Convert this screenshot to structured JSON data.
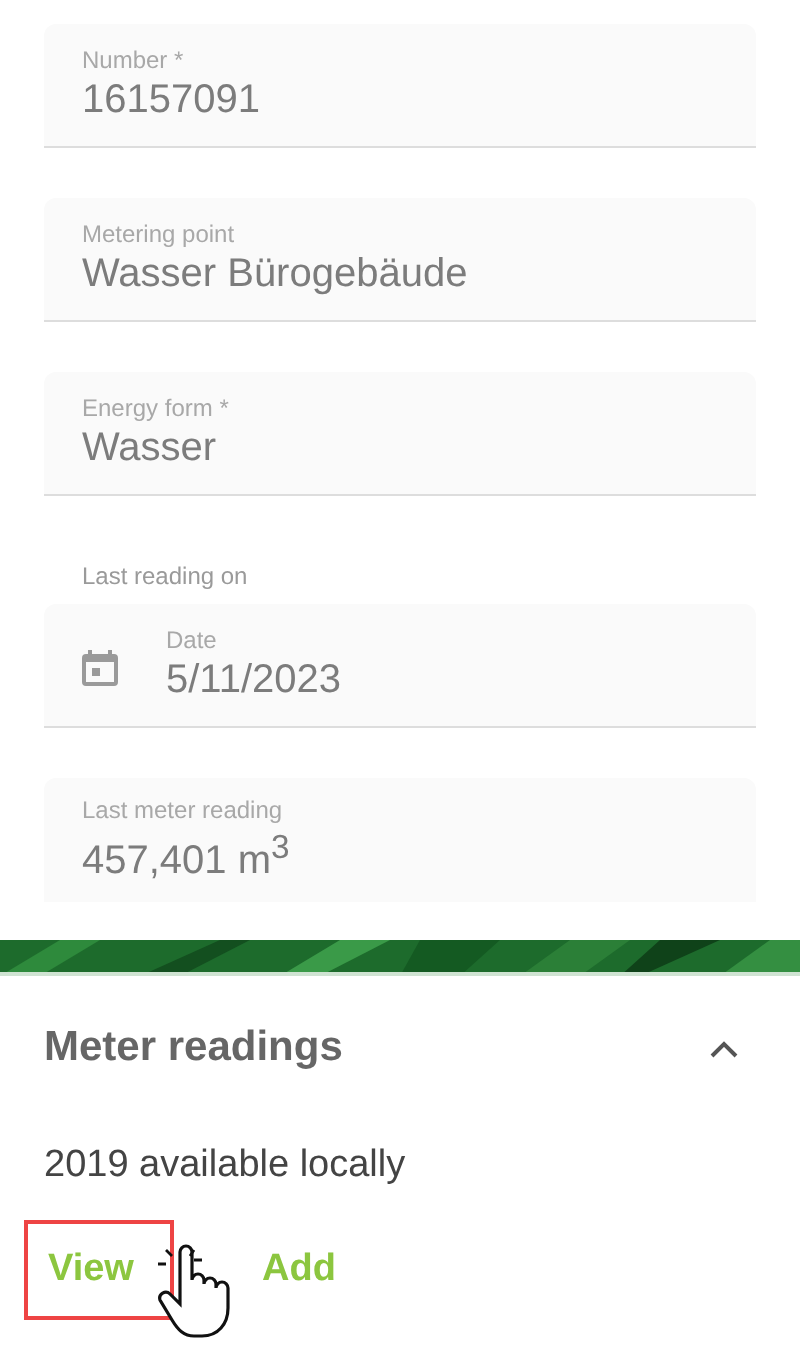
{
  "fields": [
    {
      "kind": "text",
      "label": "Number *",
      "value": "16157091"
    },
    {
      "kind": "text",
      "label": "Metering point",
      "value": "Wasser Bürogebäude"
    },
    {
      "kind": "text",
      "label": "Energy form *",
      "value": "Wasser"
    },
    {
      "kind": "date",
      "caption": "Last reading on",
      "label": "Date",
      "value": "5/11/2023"
    },
    {
      "kind": "readonly",
      "label": "Last meter reading",
      "value": "457,401 m$^{3}$"
    }
  ],
  "section": {
    "title": "Meter readings",
    "expanded": true,
    "info": "2019 available locally",
    "actions": [
      {
        "label": "View",
        "highlighted": true
      },
      {
        "label": "Add",
        "highlighted": false
      }
    ]
  }
}
